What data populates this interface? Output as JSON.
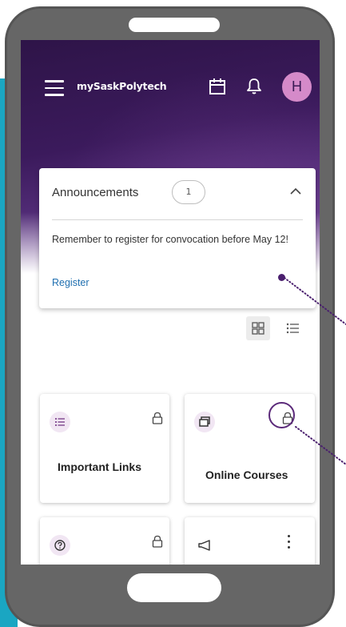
{
  "app": {
    "brand": "mySaskPolytech",
    "avatar_initial": "H"
  },
  "colors": {
    "hero": "#3b1a5c",
    "accent": "#1f6fb0",
    "avatar_bg": "#d58ac9",
    "tile_icon_bg": "#f1e6f3"
  },
  "icons": {
    "menu": "hamburger-icon",
    "calendar": "calendar-icon",
    "bell": "bell-icon",
    "chevron": "chevron-up-icon",
    "grid_view": "grid-view-icon",
    "list_view": "list-view-icon",
    "lock": "lock-icon"
  },
  "announcements": {
    "title": "Announcements",
    "count": "1",
    "message": "Remember to register for convocation before May 12!",
    "link_label": "Register"
  },
  "tiles": [
    {
      "label": "Important Links",
      "icon": "list-icon",
      "action": "lock-icon"
    },
    {
      "label": "Online Courses",
      "icon": "windows-icon",
      "action": "lock-icon"
    },
    {
      "label": "",
      "icon": "help-circle-icon",
      "action": "lock-icon"
    },
    {
      "label": "",
      "icon": "megaphone-icon",
      "action": "more-vertical-icon"
    }
  ]
}
